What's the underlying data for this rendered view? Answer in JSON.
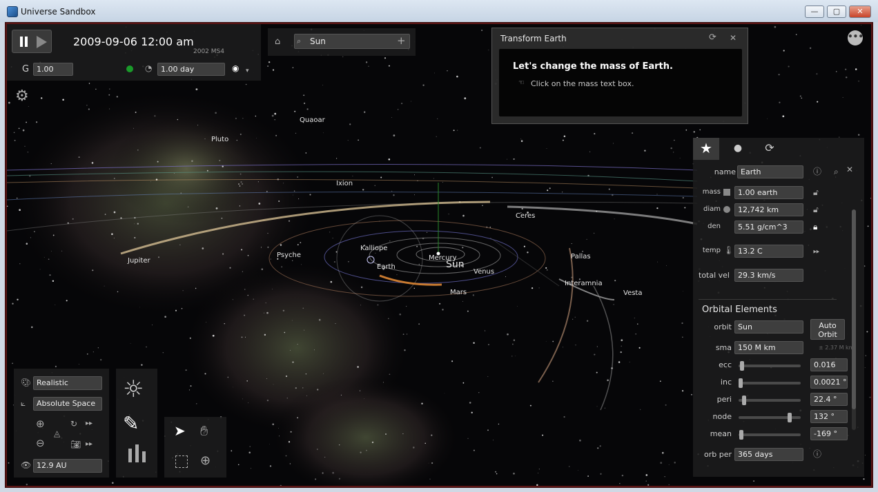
{
  "window": {
    "title": "Universe Sandbox",
    "minimize": "—",
    "maximize": "▢",
    "close": "✕"
  },
  "top_left": {
    "datetime": "2009-09-06 12:00 am",
    "subtitle": "2002 MS4",
    "g_label": "G",
    "g_value": "1.00",
    "timestep": "1.00 day",
    "pause_icon": "pause-icon",
    "play_icon": "play-icon"
  },
  "search": {
    "value": "Sun",
    "add": "+"
  },
  "tutorial": {
    "title": "Transform Earth",
    "heading": "Let's change the mass of Earth.",
    "instruction": "Click on the mass text box.",
    "refresh": "⟳",
    "close": "✕"
  },
  "tabs": {
    "star": "★",
    "dot": "●",
    "orbit": "⟳"
  },
  "props": {
    "name_label": "name",
    "name_value": "Earth",
    "mass_label": "mass",
    "mass_value": "1.00 earth",
    "diam_label": "diam",
    "diam_value": "12,742 km",
    "den_label": "den",
    "den_value": "5.51 g/cm^3",
    "temp_label": "temp",
    "temp_value": "13.2 C",
    "vel_label": "total vel",
    "vel_value": "29.3 km/s"
  },
  "orbital": {
    "title": "Orbital Elements",
    "orbit_label": "orbit",
    "orbit_value": "Sun",
    "auto_orbit": "Auto Orbit",
    "sma_label": "sma",
    "sma_value": "150 M km",
    "sma_hint": "± 2.37 M km",
    "ecc_label": "ecc",
    "ecc_value": "0.016",
    "ecc_level": 0.02,
    "inc_label": "inc",
    "inc_value": "0.0021 °",
    "inc_level": 0.0,
    "peri_label": "peri",
    "peri_value": "22.4 °",
    "peri_level": 0.06,
    "node_label": "node",
    "node_value": "132 °",
    "node_level": 0.85,
    "mean_label": "mean",
    "mean_value": "-169 °",
    "mean_level": 0.01,
    "orbper_label": "orb per",
    "orbper_value": "365 days"
  },
  "view": {
    "mode": "Realistic",
    "frame": "Absolute Space",
    "distance": "12.9 AU"
  },
  "bodies": {
    "quaoar": "Quaoar",
    "pluto": "Pluto",
    "ixion": "Ixion",
    "ceres": "Ceres",
    "kalliope": "Kalliope",
    "psyche": "Psyche",
    "jupiter": "Jupiter",
    "mercury": "Mercury",
    "sun": "Sun",
    "earth": "Earth",
    "venus": "Venus",
    "pallas": "Pallas",
    "interamnia": "Interamnia",
    "vesta": "Vesta",
    "mars": "Mars"
  },
  "colors": {
    "frame": "#5a1515",
    "panel": "#1c1c1c",
    "field": "#3e3e3e",
    "accent_green": "#1a9a2a"
  }
}
